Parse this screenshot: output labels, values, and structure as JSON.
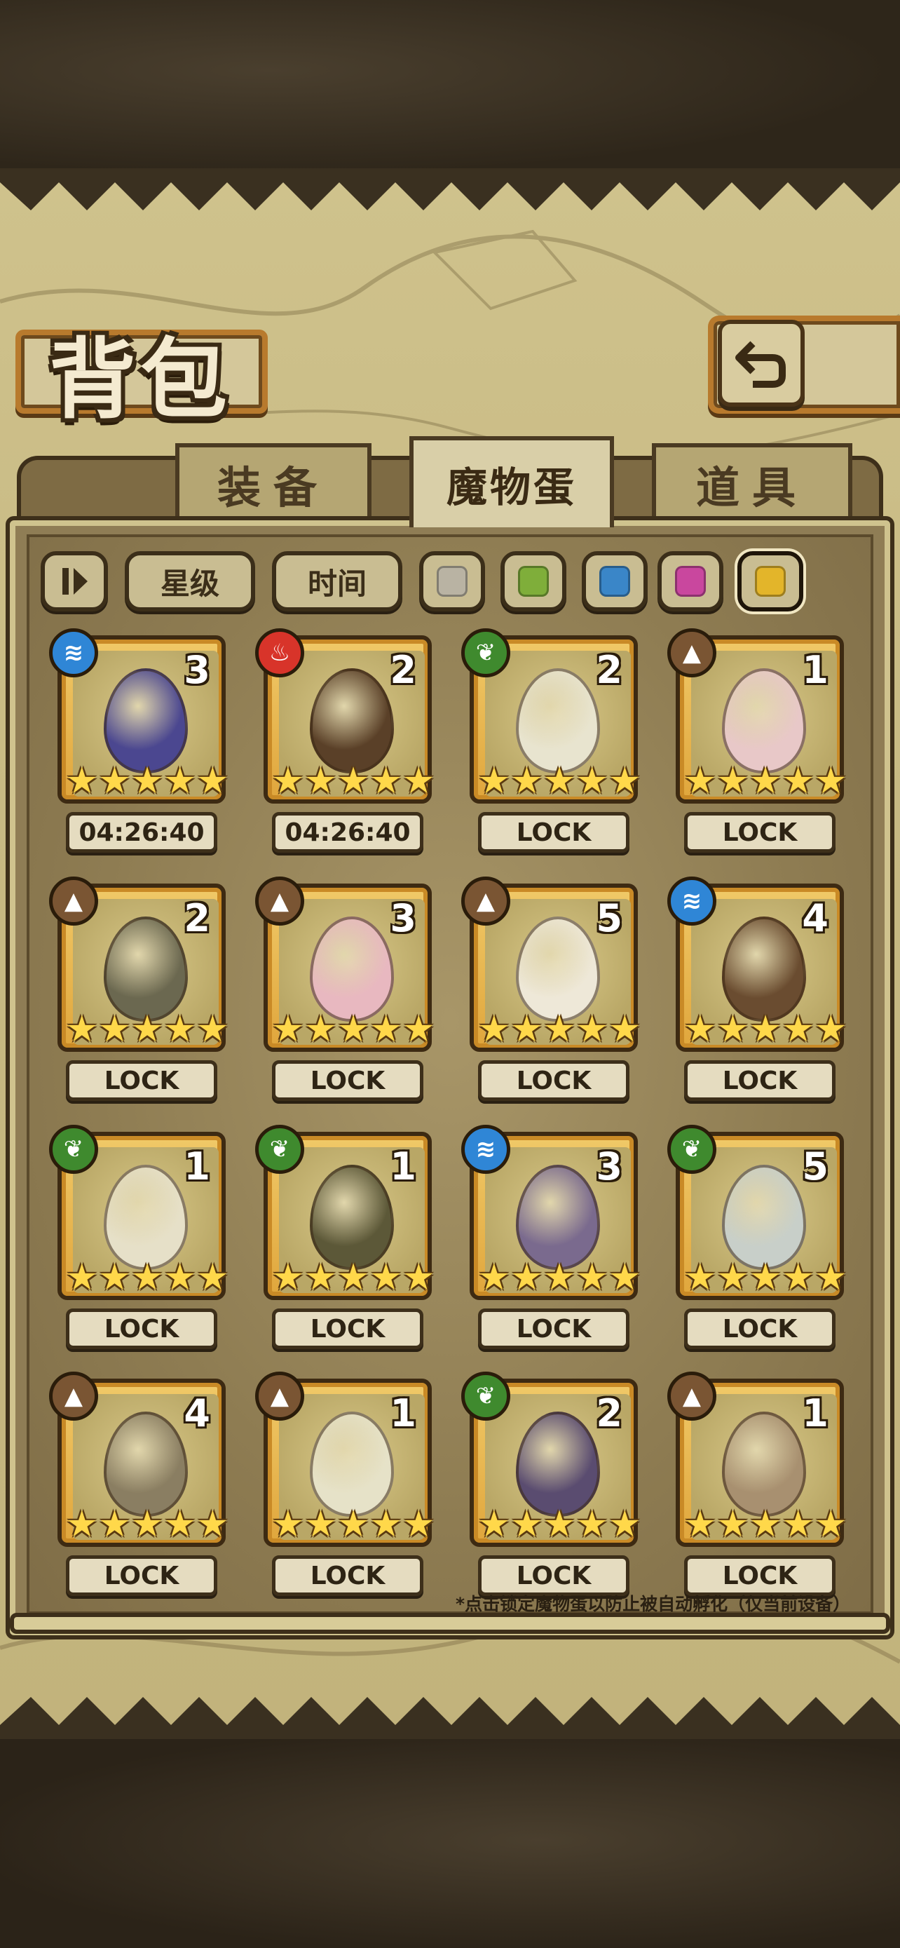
{
  "screen": {
    "title": "背包",
    "back_icon": "return-arrow-icon"
  },
  "tabs": [
    {
      "label": "装备",
      "active": false
    },
    {
      "label": "魔物蛋",
      "active": true
    },
    {
      "label": "道具",
      "active": false
    }
  ],
  "filters": {
    "sort_toggle_icon": "pause-sort-icon",
    "star_label": "星级",
    "time_label": "时间",
    "colors": [
      {
        "name": "gray",
        "hex": "#b9b3a3"
      },
      {
        "name": "green",
        "hex": "#7fae3a"
      },
      {
        "name": "blue",
        "hex": "#3a86c8"
      },
      {
        "name": "pink",
        "hex": "#c9479e"
      },
      {
        "name": "yellow",
        "hex": "#e3b52a",
        "selected": true
      }
    ]
  },
  "element_colors": {
    "water": "#2f86d6",
    "fire": "#d8342a",
    "nature": "#3f8a2e",
    "earth": "#7a5533"
  },
  "eggs": [
    {
      "element": "water",
      "count": "3",
      "stars": 5,
      "label": "04:26:40",
      "art": "dark-feather-bundle"
    },
    {
      "element": "fire",
      "count": "2",
      "stars": 5,
      "label": "04:26:40",
      "art": "bow-and-quiver"
    },
    {
      "element": "nature",
      "count": "2",
      "stars": 5,
      "label": "LOCK",
      "art": "leaf-wreath-egg"
    },
    {
      "element": "earth",
      "count": "1",
      "stars": 5,
      "label": "LOCK",
      "art": "heart-locket-egg"
    },
    {
      "element": "earth",
      "count": "2",
      "stars": 5,
      "label": "LOCK",
      "art": "bat-axe"
    },
    {
      "element": "earth",
      "count": "3",
      "stars": 5,
      "label": "LOCK",
      "art": "bunny-ears"
    },
    {
      "element": "earth",
      "count": "5",
      "stars": 5,
      "label": "LOCK",
      "art": "flower-cloud"
    },
    {
      "element": "water",
      "count": "4",
      "stars": 5,
      "label": "LOCK",
      "art": "twisted-staff"
    },
    {
      "element": "nature",
      "count": "1",
      "stars": 5,
      "label": "LOCK",
      "art": "winged-clock-egg"
    },
    {
      "element": "nature",
      "count": "1",
      "stars": 5,
      "label": "LOCK",
      "art": "chained-lantern"
    },
    {
      "element": "water",
      "count": "3",
      "stars": 5,
      "label": "LOCK",
      "art": "purple-pocket-watch"
    },
    {
      "element": "nature",
      "count": "5",
      "stars": 5,
      "label": "LOCK",
      "art": "silver-pocket-watch"
    },
    {
      "element": "earth",
      "count": "4",
      "stars": 5,
      "label": "LOCK",
      "art": "rock-egg"
    },
    {
      "element": "earth",
      "count": "1",
      "stars": 5,
      "label": "LOCK",
      "art": "cracked-egg"
    },
    {
      "element": "nature",
      "count": "2",
      "stars": 5,
      "label": "LOCK",
      "art": "dark-rune-egg"
    },
    {
      "element": "earth",
      "count": "1",
      "stars": 5,
      "label": "LOCK",
      "art": "pyramid-egg"
    }
  ],
  "footnote": "*点击锁定魔物蛋以防止被自动孵化（仅当前设备）"
}
